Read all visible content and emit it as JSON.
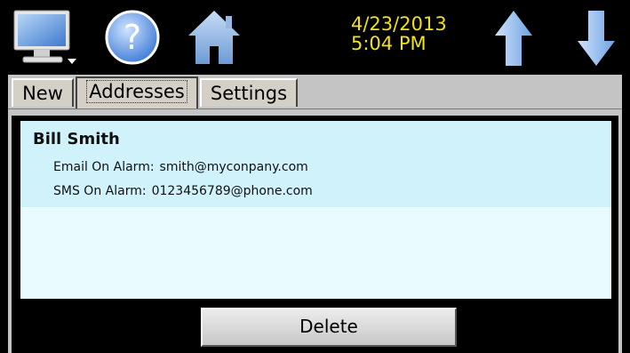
{
  "header": {
    "date": "4/23/2013",
    "time": "5:04 PM",
    "icons": [
      "monitor-icon",
      "help-icon",
      "home-icon",
      "up-arrow-icon",
      "down-arrow-icon"
    ],
    "clock_color": "#f0e21a"
  },
  "tabs": [
    {
      "label": "New",
      "selected": false
    },
    {
      "label": "Addresses",
      "selected": true
    },
    {
      "label": "Settings",
      "selected": false
    }
  ],
  "contacts": [
    {
      "name": "Bill Smith",
      "email_label": "Email On Alarm:",
      "email": "smith@myconpany.com",
      "sms_label": "SMS On Alarm:",
      "sms": "0123456789@phone.com"
    }
  ],
  "actions": {
    "delete_label": "Delete"
  },
  "colors": {
    "list_bg": "#e9fbff",
    "selected_row_bg": "#d0f3fb",
    "panel_bg": "#c4c4c4"
  }
}
